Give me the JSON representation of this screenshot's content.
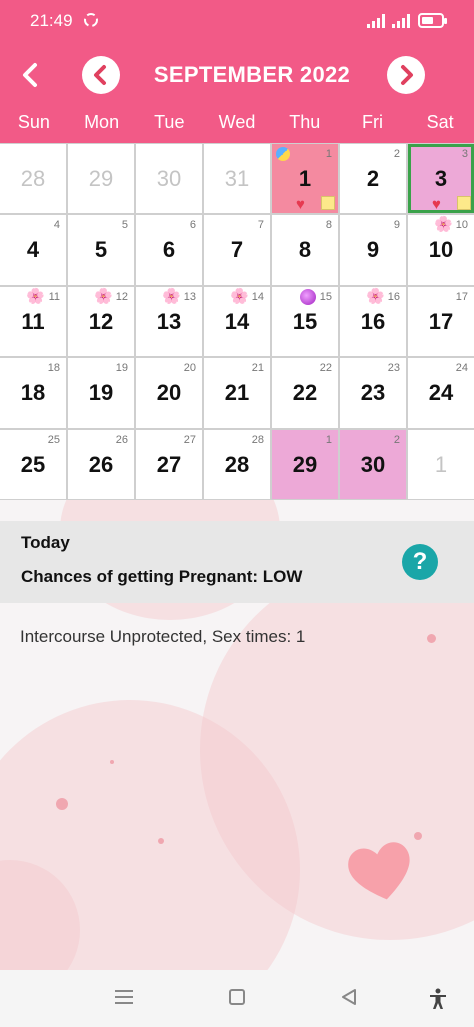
{
  "status_bar": {
    "time": "21:49"
  },
  "header": {
    "month_title": "SEPTEMBER 2022",
    "weekdays": [
      "Sun",
      "Mon",
      "Tue",
      "Wed",
      "Thu",
      "Fri",
      "Sat"
    ],
    "color": "#f25a87"
  },
  "calendar": {
    "rows": [
      [
        {
          "day": "28",
          "small": ""
        },
        {
          "day": "29",
          "small": ""
        },
        {
          "day": "30",
          "small": ""
        },
        {
          "day": "31",
          "small": ""
        },
        {
          "day": "1",
          "small": "1"
        },
        {
          "day": "2",
          "small": "2"
        },
        {
          "day": "3",
          "small": "3"
        }
      ],
      [
        {
          "day": "4",
          "small": "4"
        },
        {
          "day": "5",
          "small": "5"
        },
        {
          "day": "6",
          "small": "6"
        },
        {
          "day": "7",
          "small": "7"
        },
        {
          "day": "8",
          "small": "8"
        },
        {
          "day": "9",
          "small": "9"
        },
        {
          "day": "10",
          "small": "10"
        }
      ],
      [
        {
          "day": "11",
          "small": "11"
        },
        {
          "day": "12",
          "small": "12"
        },
        {
          "day": "13",
          "small": "13"
        },
        {
          "day": "14",
          "small": "14"
        },
        {
          "day": "15",
          "small": "15"
        },
        {
          "day": "16",
          "small": "16"
        },
        {
          "day": "17",
          "small": "17"
        }
      ],
      [
        {
          "day": "18",
          "small": "18"
        },
        {
          "day": "19",
          "small": "19"
        },
        {
          "day": "20",
          "small": "20"
        },
        {
          "day": "21",
          "small": "21"
        },
        {
          "day": "22",
          "small": "22"
        },
        {
          "day": "23",
          "small": "23"
        },
        {
          "day": "24",
          "small": "24"
        }
      ],
      [
        {
          "day": "25",
          "small": "25"
        },
        {
          "day": "26",
          "small": "26"
        },
        {
          "day": "27",
          "small": "27"
        },
        {
          "day": "28",
          "small": "28"
        },
        {
          "day": "29",
          "small": "1"
        },
        {
          "day": "30",
          "small": "2"
        },
        {
          "day": "1",
          "small": ""
        }
      ]
    ]
  },
  "info": {
    "today_label": "Today",
    "chances_text": "Chances of getting Pregnant:  LOW",
    "help_glyph": "?",
    "intercourse_text": "Intercourse Unprotected, Sex times: 1"
  }
}
